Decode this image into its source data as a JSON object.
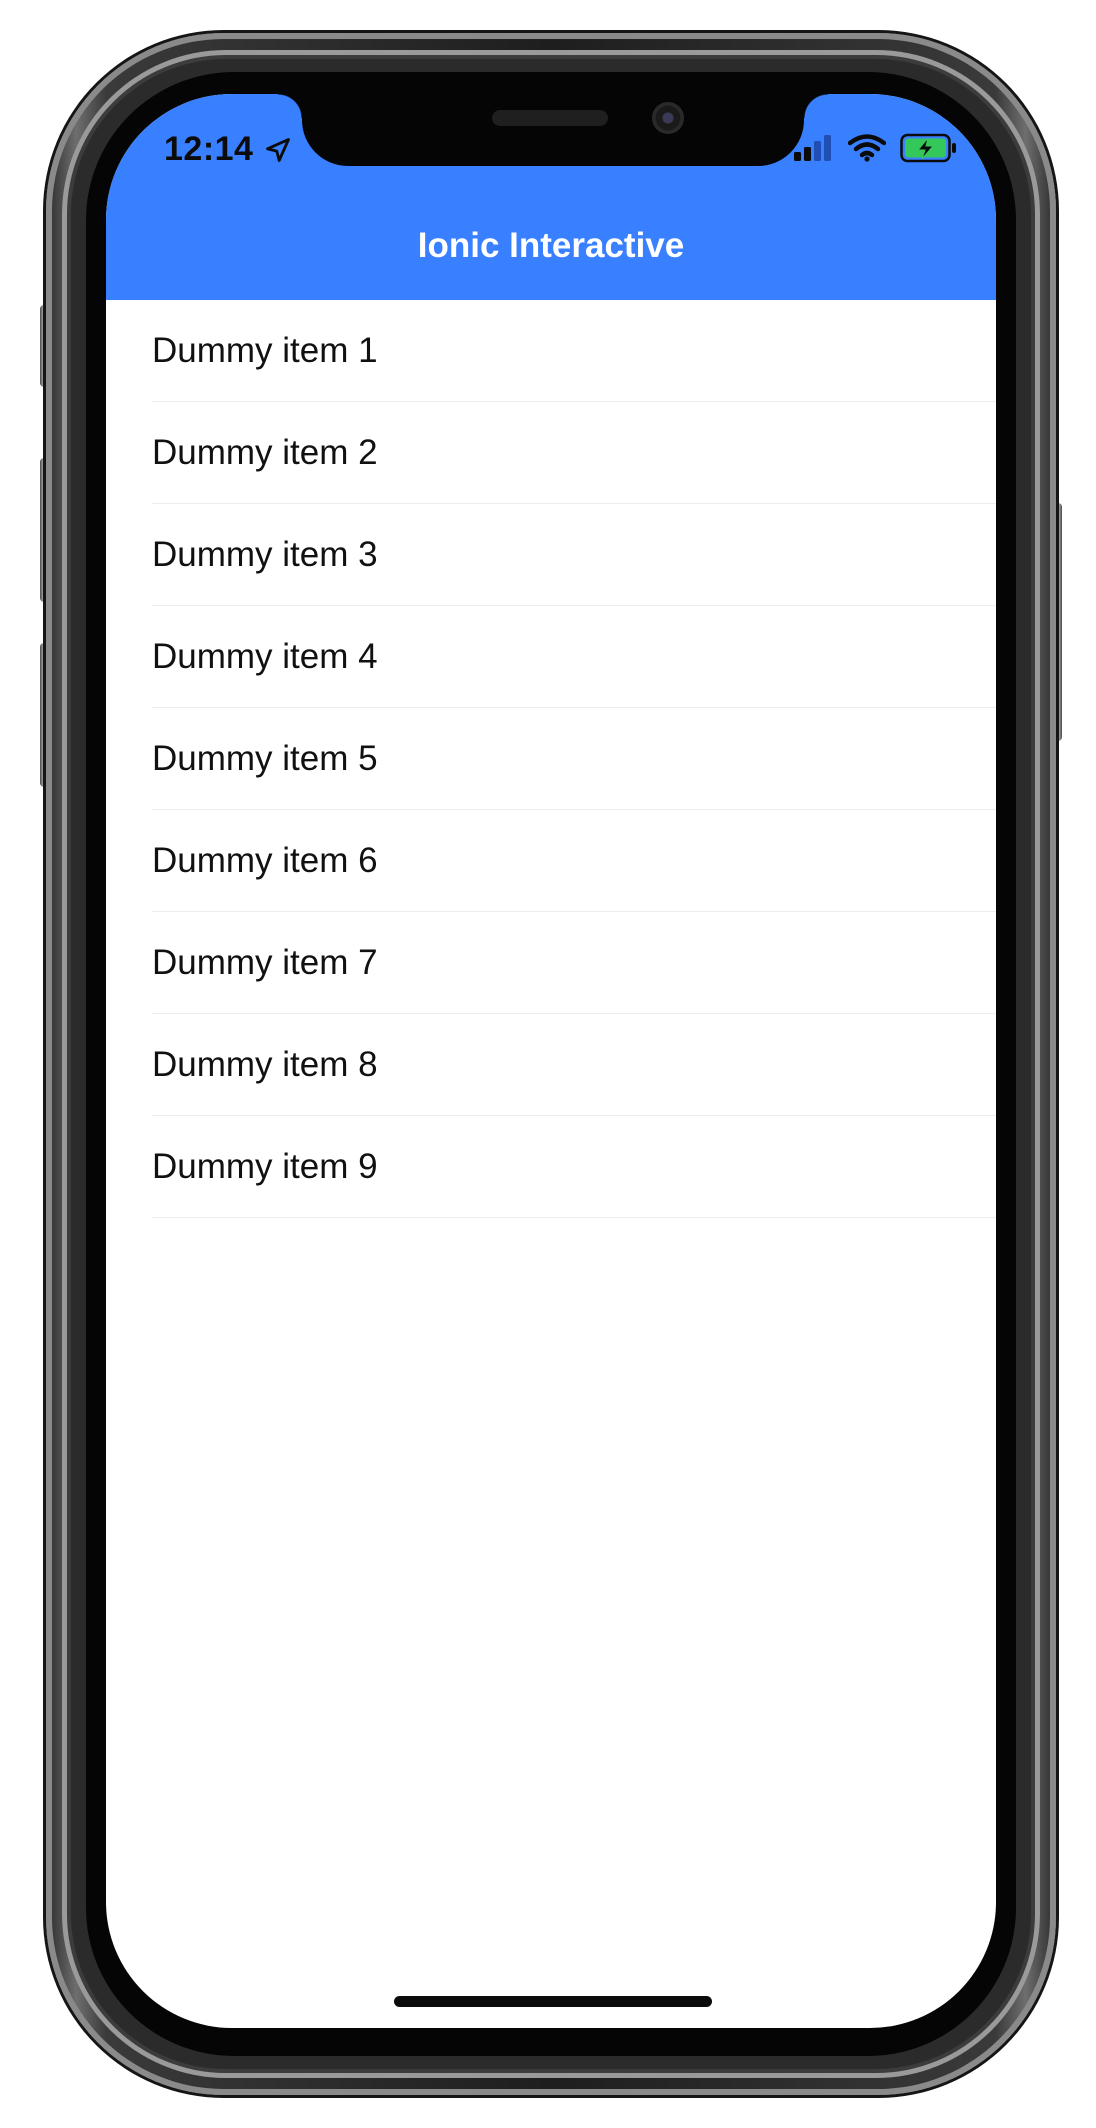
{
  "status_bar": {
    "time": "12:14",
    "icons": [
      "location-arrow-icon",
      "cellular-signal-icon",
      "wifi-icon",
      "battery-charging-icon"
    ]
  },
  "header": {
    "title": "Ionic Interactive"
  },
  "list": {
    "items": [
      {
        "label": "Dummy item 1"
      },
      {
        "label": "Dummy item 2"
      },
      {
        "label": "Dummy item 3"
      },
      {
        "label": "Dummy item 4"
      },
      {
        "label": "Dummy item 5"
      },
      {
        "label": "Dummy item 6"
      },
      {
        "label": "Dummy item 7"
      },
      {
        "label": "Dummy item 8"
      },
      {
        "label": "Dummy item 9"
      }
    ]
  },
  "colors": {
    "toolbar_primary": "#3880ff",
    "battery_charging": "#34c759"
  }
}
